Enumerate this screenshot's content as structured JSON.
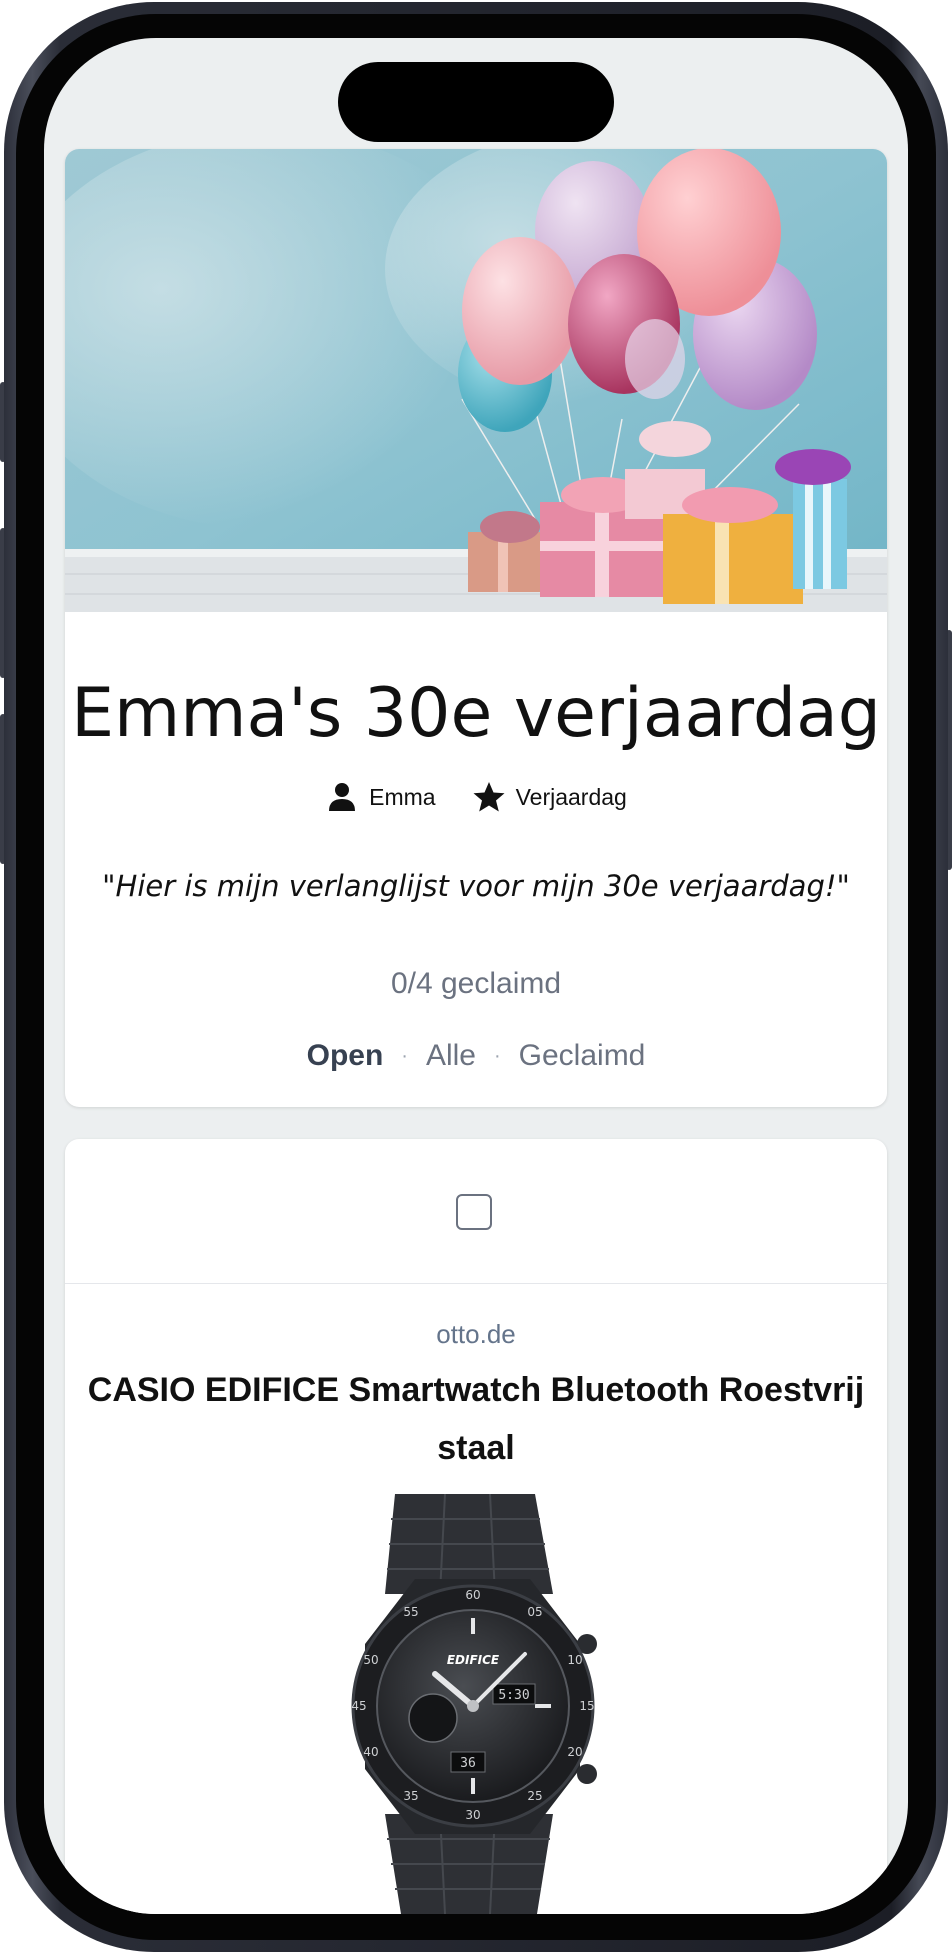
{
  "wishlist": {
    "title": "Emma's 30e verjaardag",
    "owner": "Emma",
    "occasion": "Verjaardag",
    "message": "\"Hier is mijn verlanglijst voor mijn 30e verjaardag!\"",
    "progress": "0/4 geclaimd",
    "filters": {
      "open": "Open",
      "all": "Alle",
      "claimed": "Geclaimd",
      "separator": "·"
    }
  },
  "item": {
    "domain": "otto.de",
    "title": "CASIO EDIFICE Smartwatch Bluetooth Roestvrij staal",
    "checked": false
  },
  "icons": {
    "owner": "person-icon",
    "occasion": "star-icon"
  },
  "colors": {
    "screen_bg": "#eceff0",
    "muted_text": "#6b7280",
    "active_filter": "#374151",
    "domain_text": "#64748b"
  }
}
